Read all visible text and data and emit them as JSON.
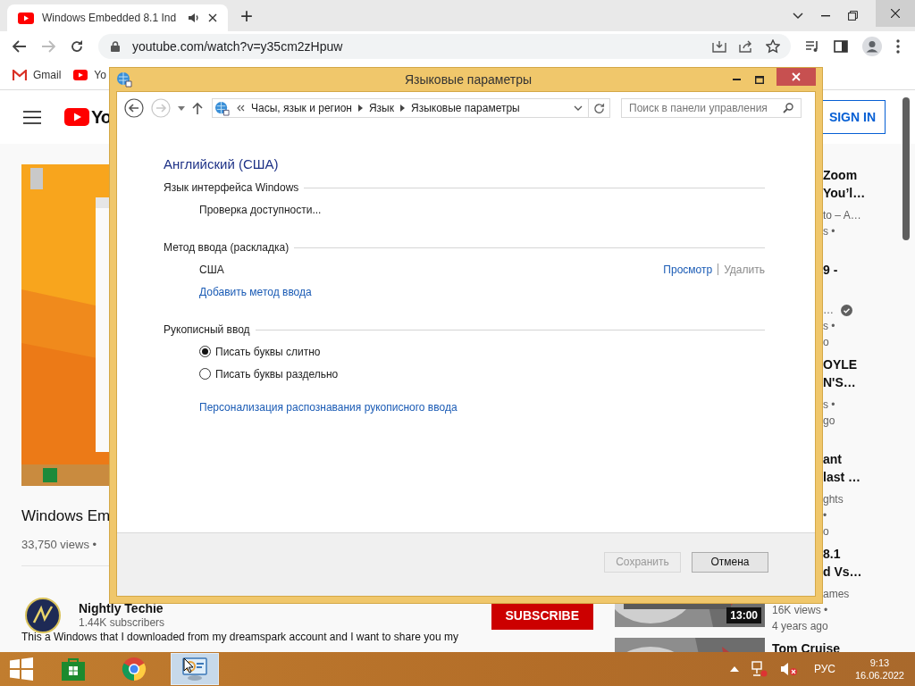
{
  "browser": {
    "tab": {
      "title": "Windows Embedded 8.1 Ind"
    },
    "new_tab": "+",
    "url": "youtube.com/watch?v=y35cm2zHpuw",
    "forward_enabled": false,
    "bookmarks": [
      {
        "label": "Gmail",
        "kind": "gmail"
      },
      {
        "label": "Yo",
        "kind": "youtube"
      }
    ]
  },
  "page": {
    "logo_text": "Yo",
    "sign_in": "SIGN IN",
    "video": {
      "kind": "picture"
    },
    "title": "Windows Em",
    "views": "33,750 views •",
    "channel": {
      "name": "Nightly Techie",
      "subscribers": "1.44K subscribers"
    },
    "subscribe": "SUBSCRIBE",
    "description": "This a Windows that I downloaded from my dreamspark account and I want to share you my",
    "related": [
      {
        "lines": [
          {
            "text": "Zoom",
            "kind": "title",
            "cut": true
          },
          {
            "text": "You’l…",
            "kind": "title",
            "cut": true
          },
          {
            "text": "to – A…",
            "kind": "meta",
            "cut": true
          },
          {
            "text": "s •",
            "kind": "meta",
            "cut": true
          }
        ]
      },
      {
        "lines": [
          {
            "text": "9 -",
            "kind": "title",
            "cut": true
          },
          {
            "text": "…",
            "kind": "meta",
            "cut": true,
            "verified": true
          },
          {
            "text": "s •",
            "kind": "meta",
            "cut": true
          },
          {
            "text": "o",
            "kind": "meta",
            "cut": true
          }
        ]
      },
      {
        "lines": [
          {
            "text": "OYLE",
            "kind": "title",
            "cut": true
          },
          {
            "text": "N'S…",
            "kind": "title",
            "cut": true
          },
          {
            "text": "s •",
            "kind": "meta",
            "cut": true
          },
          {
            "text": "go",
            "kind": "meta",
            "cut": true
          }
        ]
      },
      {
        "lines": [
          {
            "text": "ant",
            "kind": "title",
            "cut": true
          },
          {
            "text": "last …",
            "kind": "title",
            "cut": true
          },
          {
            "text": "ghts",
            "kind": "meta",
            "cut": true
          },
          {
            "text": "•",
            "kind": "meta",
            "cut": true
          },
          {
            "text": "o",
            "kind": "meta",
            "cut": true
          }
        ]
      },
      {
        "thumbnail": {
          "kind": "picture",
          "duration": "13:00"
        },
        "lines": [
          {
            "text": "8.1",
            "kind": "title",
            "cut": true
          },
          {
            "text": "d Vs…",
            "kind": "title",
            "cut": true
          },
          {
            "text": "ames",
            "kind": "meta",
            "cut": true
          },
          {
            "text": "16K views •",
            "kind": "meta",
            "cut": false
          },
          {
            "text": "4 years ago",
            "kind": "meta",
            "cut": false
          }
        ]
      },
      {
        "thumbnail": {
          "kind": "picture"
        },
        "lines": [
          {
            "text": "Tom Cruise",
            "kind": "title",
            "cut": false
          }
        ]
      }
    ]
  },
  "dialog": {
    "title": "Языковые параметры",
    "back_enabled": true,
    "forward_enabled": false,
    "breadcrumb": [
      "Часы, язык и регион",
      "Язык",
      "Языковые параметры"
    ],
    "search": {
      "placeholder": "Поиск в панели управления"
    },
    "heading": "Английский (США)",
    "sections": [
      {
        "title": "Язык интерфейса Windows",
        "rows": [
          {
            "kind": "status",
            "text": "Проверка доступности..."
          }
        ]
      },
      {
        "title": "Метод ввода (раскладка)",
        "rows": [
          {
            "kind": "method",
            "text": "США",
            "actions": [
              {
                "label": "Просмотр",
                "disabled": false
              },
              {
                "label": "Удалить",
                "disabled": true
              }
            ]
          },
          {
            "kind": "link",
            "text": "Добавить метод ввода"
          }
        ]
      },
      {
        "title": "Рукописный ввод",
        "rows": [
          {
            "kind": "radio",
            "text": "Писать буквы слитно",
            "selected": true
          },
          {
            "kind": "radio",
            "text": "Писать буквы раздельно",
            "selected": false
          },
          {
            "kind": "link",
            "text": "Персонализация распознавания рукописного ввода"
          }
        ]
      }
    ],
    "buttons": [
      {
        "label": "Сохранить",
        "disabled": true
      },
      {
        "label": "Отмена",
        "disabled": false
      }
    ]
  },
  "taskbar": {
    "apps": [
      {
        "kind": "store",
        "active": false
      },
      {
        "kind": "chrome",
        "active": false
      },
      {
        "kind": "control-panel",
        "active": true
      }
    ],
    "language": "РУС",
    "time": "9:13",
    "date": "16.06.2022"
  }
}
